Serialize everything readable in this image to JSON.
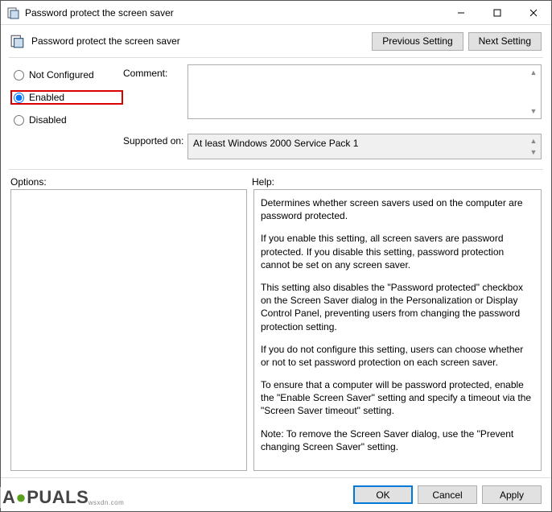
{
  "titlebar": {
    "text": "Password protect the screen saver"
  },
  "header": {
    "title": "Password protect the screen saver",
    "prev": "Previous Setting",
    "next": "Next Setting"
  },
  "config": {
    "notConfigured": "Not Configured",
    "enabled": "Enabled",
    "disabled": "Disabled",
    "commentLabel": "Comment:",
    "supportedLabel": "Supported on:",
    "supportedText": "At least Windows 2000 Service Pack 1"
  },
  "labels": {
    "options": "Options:",
    "help": "Help:"
  },
  "help": {
    "p1": "Determines whether screen savers used on the computer are password protected.",
    "p2": "If you enable this setting, all screen savers are password protected. If you disable this setting, password protection cannot be set on any screen saver.",
    "p3": "This setting also disables the \"Password protected\" checkbox on the Screen Saver dialog in the Personalization or Display Control Panel, preventing users from changing the password protection setting.",
    "p4": "If you do not configure this setting, users can choose whether or not to set password protection on each screen saver.",
    "p5": "To ensure that a computer will be password protected, enable the \"Enable Screen Saver\" setting and specify a timeout via the \"Screen Saver timeout\" setting.",
    "p6": "Note: To remove the Screen Saver dialog, use the \"Prevent changing Screen Saver\" setting."
  },
  "footer": {
    "ok": "OK",
    "cancel": "Cancel",
    "apply": "Apply"
  },
  "watermark": {
    "text_pre": "A",
    "text_post": "PUALS",
    "sub": "wsxdn.com"
  }
}
